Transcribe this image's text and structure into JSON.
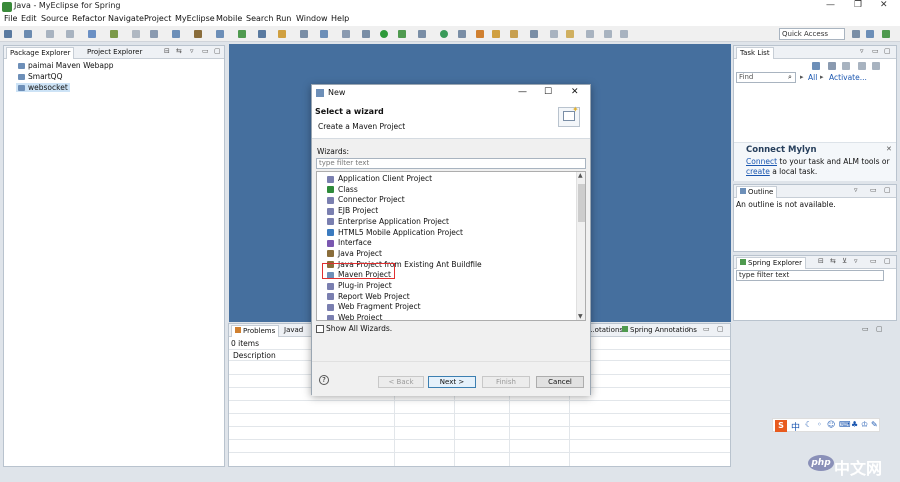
{
  "window": {
    "title": "Java - MyEclipse for Spring",
    "controls": [
      "—",
      "❐",
      "✕"
    ]
  },
  "menu": [
    "File",
    "Edit",
    "Source",
    "Refactor",
    "Navigate",
    "Project",
    "MyEclipse",
    "Mobile",
    "Search",
    "Run",
    "Window",
    "Help"
  ],
  "toolbar": {
    "quick_access_placeholder": "Quick Access"
  },
  "left_panel": {
    "tabs": [
      "Package Explorer",
      "Project Explorer"
    ],
    "tree": [
      "paimai Maven Webapp",
      "SmartQQ",
      "websocket"
    ],
    "selected": "websocket"
  },
  "bottom_panel": {
    "tabs": [
      "Problems",
      "Javad",
      "...otations",
      "Spring Annotations"
    ],
    "count_text": "0 items",
    "column_header": "Description"
  },
  "task_list": {
    "tab": "Task List",
    "find_placeholder": "Find",
    "all_label": "All",
    "activate_label": "Activate...",
    "mylyn_title": "Connect Mylyn",
    "mylyn_link1": "Connect",
    "mylyn_text1": " to your task and ALM tools or",
    "mylyn_link2": "create",
    "mylyn_text2": " a local task."
  },
  "outline": {
    "tab": "Outline",
    "message": "An outline is not available."
  },
  "spring_explorer": {
    "tab": "Spring Explorer",
    "filter_placeholder": "type filter text"
  },
  "dialog": {
    "title": "New",
    "heading": "Select a wizard",
    "subheading": "Create a Maven Project",
    "wizards_label": "Wizards:",
    "filter_placeholder": "type filter text",
    "items": [
      {
        "label": "Application Client Project",
        "color": "#7a7fb0"
      },
      {
        "label": "Class",
        "color": "#2e8b3a"
      },
      {
        "label": "Connector Project",
        "color": "#7a7fb0"
      },
      {
        "label": "EJB Project",
        "color": "#7a7fb0"
      },
      {
        "label": "Enterprise Application Project",
        "color": "#7a7fb0"
      },
      {
        "label": "HTML5 Mobile Application Project",
        "color": "#3b7bbf"
      },
      {
        "label": "Interface",
        "color": "#7a57b0"
      },
      {
        "label": "Java Project",
        "color": "#8a6d3b"
      },
      {
        "label": "Java Project from Existing Ant Buildfile",
        "color": "#8a6d3b"
      },
      {
        "label": "Maven Project",
        "color": "#6d8fb8"
      },
      {
        "label": "Plug-in Project",
        "color": "#7a7fb0"
      },
      {
        "label": "Report Web Project",
        "color": "#7a7fb0"
      },
      {
        "label": "Web Fragment Project",
        "color": "#7a7fb0"
      },
      {
        "label": "Web Project",
        "color": "#7a7fb0"
      }
    ],
    "show_all_label": "Show All Wizards.",
    "back_label": "< Back",
    "next_label": "Next >",
    "finish_label": "Finish",
    "cancel_label": "Cancel"
  },
  "watermark": {
    "badge": "php",
    "text": "中文网"
  },
  "ime": {
    "label": "中"
  }
}
